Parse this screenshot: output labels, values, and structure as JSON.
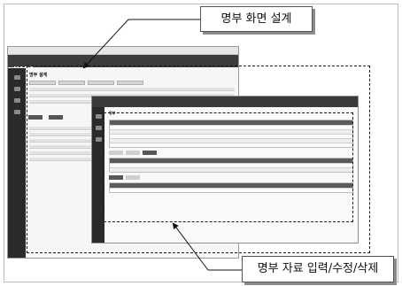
{
  "annotations": {
    "top_label": "명부 화면 설계",
    "bottom_label": "명부 자료 입력/수정/삭제"
  },
  "back_window": {
    "logo": "NARA",
    "page_title": "명부 설계"
  },
  "front_window": {
    "logo": "NARA",
    "page_title": "명부"
  },
  "colors": {
    "appbar": "#3c3c3c",
    "dashed_border": "#1a1a1a",
    "callout_shadow": "#8c8c8c"
  }
}
